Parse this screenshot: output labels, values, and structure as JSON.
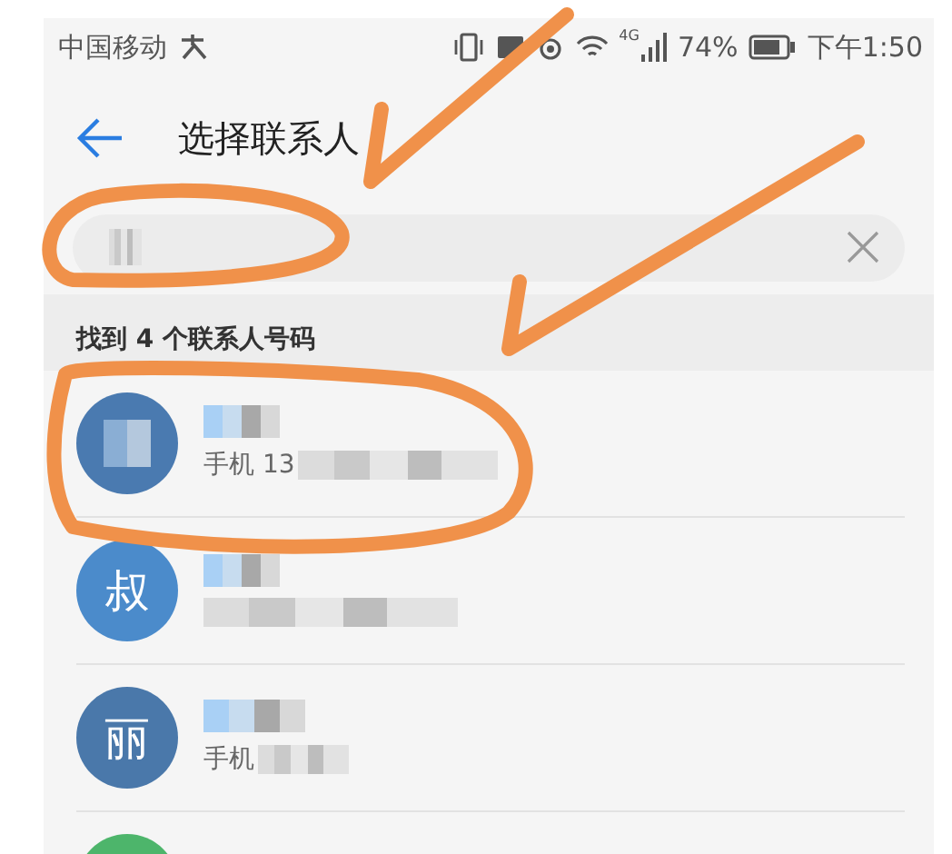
{
  "status_bar": {
    "carrier": "中国移动",
    "network": "4G",
    "battery": "74%",
    "time": "下午1:50"
  },
  "header": {
    "title": "选择联系人"
  },
  "results_label": "找到 4 个联系人号码",
  "contacts": [
    {
      "color": "#4a7ab0",
      "detail": "手机 13"
    },
    {
      "color": "#4b8bcb",
      "avatar": "叔"
    },
    {
      "color": "#4a78aa",
      "avatar": "丽",
      "detail": "手机"
    },
    {
      "color": "#4db56b"
    }
  ]
}
